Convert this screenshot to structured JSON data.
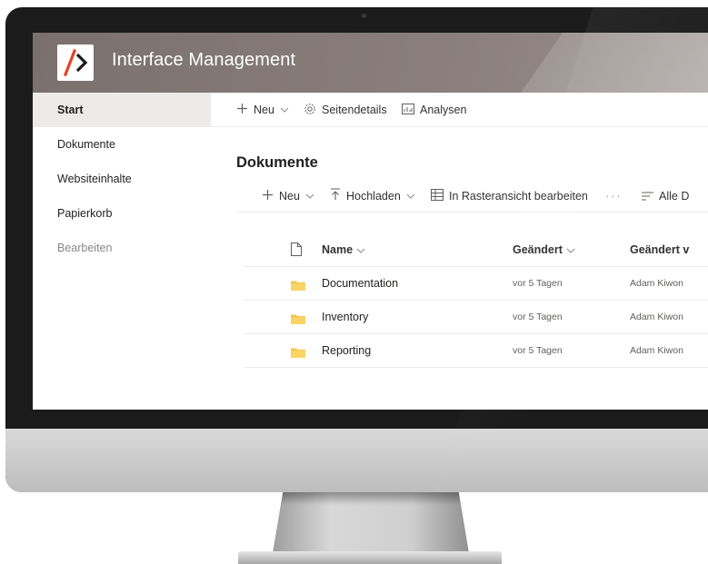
{
  "site": {
    "title": "Interface Management",
    "accent": "#e84324",
    "header_color": "#7a706e"
  },
  "nav": {
    "items": [
      {
        "label": "Start",
        "active": true
      },
      {
        "label": "Dokumente"
      },
      {
        "label": "Websiteinhalte"
      },
      {
        "label": "Papierkorb"
      },
      {
        "label": "Bearbeiten",
        "muted": true
      }
    ]
  },
  "commandbar": {
    "new_label": "Neu",
    "page_details_label": "Seitendetails",
    "analytics_label": "Analysen",
    "icons": [
      "plus-icon",
      "gear-icon",
      "analytics-icon"
    ]
  },
  "library": {
    "title": "Dokumente",
    "toolbar": {
      "new_label": "Neu",
      "upload_label": "Hochladen",
      "grid_edit_label": "In Rasteransicht bearbeiten",
      "more_label": "···",
      "view_label": "Alle D"
    },
    "columns": {
      "name": "Name",
      "modified": "Geändert",
      "modified_by": "Geändert v"
    },
    "rows": [
      {
        "name": "Documentation",
        "modified": "vor 5 Tagen",
        "modified_by": "Adam Kiwon"
      },
      {
        "name": "Inventory",
        "modified": "vor 5 Tagen",
        "modified_by": "Adam Kiwon"
      },
      {
        "name": "Reporting",
        "modified": "vor 5 Tagen",
        "modified_by": "Adam Kiwon"
      }
    ],
    "folder_color": "#f5c24d"
  }
}
